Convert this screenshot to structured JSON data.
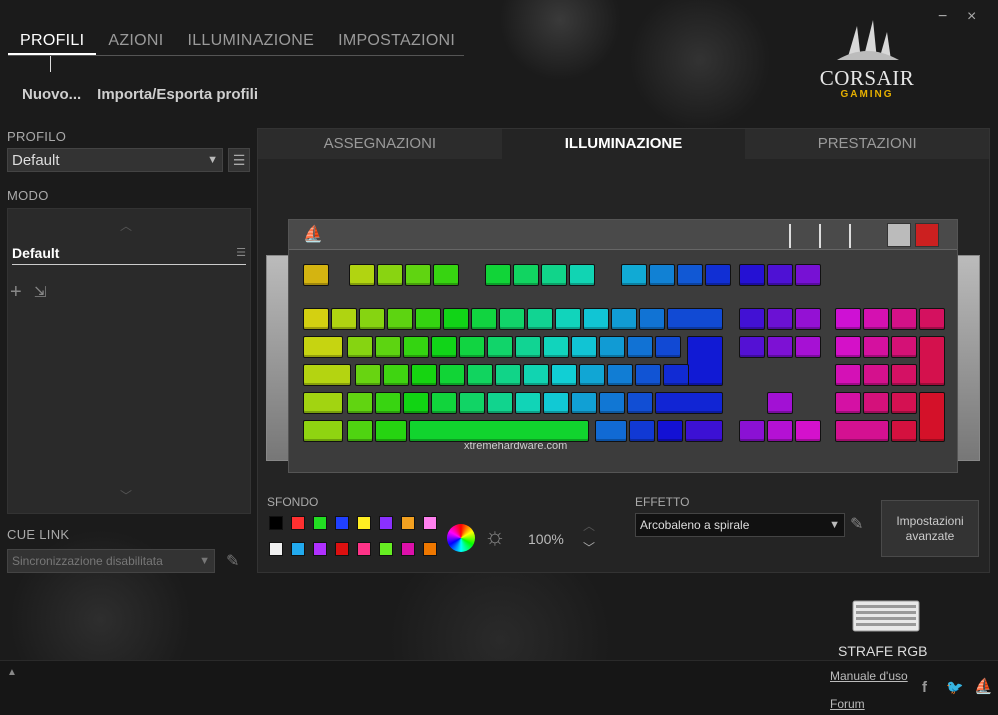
{
  "nav": {
    "tabs": [
      {
        "label": "PROFILI"
      },
      {
        "label": "AZIONI"
      },
      {
        "label": "ILLUMINAZIONE"
      },
      {
        "label": "IMPOSTAZIONI"
      }
    ],
    "active": "PROFILI"
  },
  "window": {
    "minimize": "−",
    "close": "×"
  },
  "logo": {
    "brand": "CORSAIR",
    "sub": "GAMING"
  },
  "subnav": {
    "new_label": "Nuovo...",
    "import_label": "Importa/Esporta profili"
  },
  "profile": {
    "section_label": "PROFILO",
    "value": "Default"
  },
  "mode": {
    "section_label": "MODO",
    "item": "Default"
  },
  "cue_link": {
    "section_label": "CUE LINK",
    "value": "Sincronizzazione disabilitata"
  },
  "main": {
    "tabs": [
      {
        "label": "ASSEGNAZIONI"
      },
      {
        "label": "ILLUMINAZIONE"
      },
      {
        "label": "PRESTAZIONI"
      }
    ],
    "active": "ILLUMINAZIONE"
  },
  "watermark": "xtremehardware.com",
  "background": {
    "section_label": "SFONDO",
    "swatches": [
      "#000000",
      "#ff3030",
      "#22dd22",
      "#2040ff",
      "#ffee22",
      "#8a30ff",
      "#f2a020",
      "#ff80ee",
      "#f0f0f0",
      "#22aaee",
      "#b030ff",
      "#dd1010",
      "#ff3388",
      "#66ee22",
      "#dd10aa",
      "#ee7700"
    ],
    "brightness": "100%"
  },
  "effect": {
    "section_label": "EFFETTO",
    "value": "Arcobaleno a spirale",
    "advanced_button": "Impostazioni avanzate"
  },
  "device": {
    "name": "STRAFE RGB"
  },
  "footer": {
    "manual_link": "Manuale d'uso",
    "forum_link": "Forum"
  },
  "colors": {
    "accent": "#ffffff",
    "brand_yellow": "#e6b000"
  }
}
